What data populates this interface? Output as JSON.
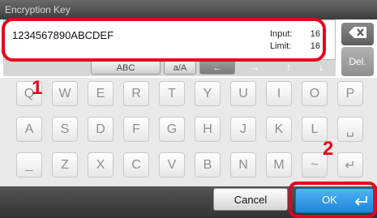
{
  "dialog": {
    "title": "Encryption Key"
  },
  "input": {
    "value": "1234567890ABCDEF",
    "input_label": "Input:",
    "input_count": "16",
    "limit_label": "Limit:",
    "limit_count": "16"
  },
  "side_keys": {
    "backspace_icon": "backspace-icon",
    "del_label": "Del."
  },
  "mode_row": {
    "mode_a": "ABC",
    "mode_b": "a/A",
    "arrows": [
      "←",
      "→",
      "↑",
      "↓"
    ]
  },
  "keyboard": {
    "rows": [
      [
        "Q",
        "W",
        "E",
        "R",
        "T",
        "Y",
        "U",
        "I",
        "O",
        "P"
      ],
      [
        "A",
        "S",
        "D",
        "F",
        "G",
        "H",
        "J",
        "K",
        "L",
        "␣"
      ],
      [
        "_",
        "Z",
        "X",
        "C",
        "V",
        "B",
        "N",
        "M",
        "~",
        "↵"
      ]
    ]
  },
  "buttons": {
    "cancel": "Cancel",
    "ok": "OK"
  },
  "annotations": {
    "callout_1": "1",
    "callout_2": "2",
    "color": "#e8001c"
  },
  "colors": {
    "ok_blue": "#2a8fe0",
    "title_bar": "#4a4a4a",
    "key_text": "#8f8f8f"
  }
}
